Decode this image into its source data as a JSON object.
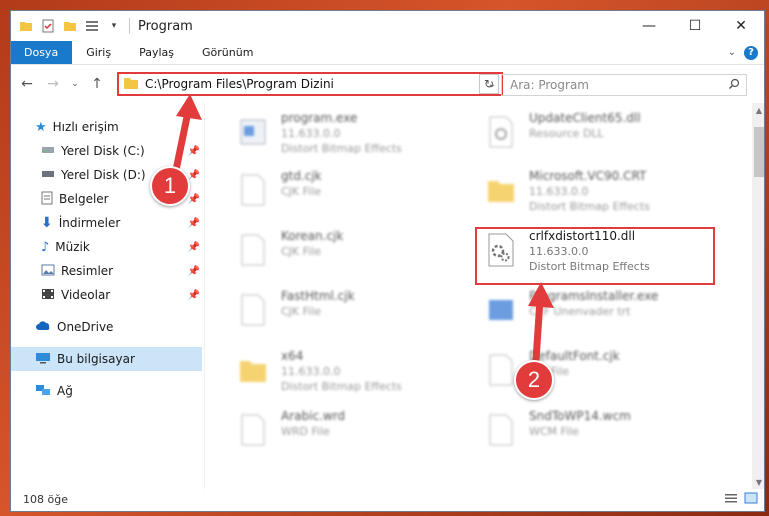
{
  "window": {
    "title": "Program"
  },
  "ribbon": {
    "tabs": [
      "Dosya",
      "Giriş",
      "Paylaş",
      "Görünüm"
    ],
    "help": "?"
  },
  "address": {
    "path": "C:\\Program Files\\Program Dizini",
    "search_placeholder": "Ara: Program"
  },
  "nav": {
    "quick_access": "Hızlı erişim",
    "items": [
      {
        "label": "Yerel Disk (C:)",
        "icon": "drive-icon"
      },
      {
        "label": "Yerel Disk (D:)",
        "icon": "drive-icon"
      },
      {
        "label": "Belgeler",
        "icon": "documents-icon"
      },
      {
        "label": "İndirmeler",
        "icon": "download-icon"
      },
      {
        "label": "Müzik",
        "icon": "music-icon"
      },
      {
        "label": "Resimler",
        "icon": "pictures-icon"
      },
      {
        "label": "Videolar",
        "icon": "video-icon"
      }
    ],
    "onedrive": "OneDrive",
    "this_pc": "Bu bilgisayar",
    "network": "Ağ"
  },
  "files": {
    "left": [
      {
        "name": "program.exe",
        "line1": "11.633.0.0",
        "line2": "Distort Bitmap Effects"
      },
      {
        "name": "gtd.cjk",
        "line1": "CJK File",
        "line2": ""
      },
      {
        "name": "Korean.cjk",
        "line1": "CJK File",
        "line2": ""
      },
      {
        "name": "FastHtml.cjk",
        "line1": "CJK File",
        "line2": ""
      },
      {
        "name": "x64",
        "line1": "11.633.0.0",
        "line2": "Distort Bitmap Effects"
      },
      {
        "name": "Arabic.wrd",
        "line1": "WRD File",
        "line2": ""
      }
    ],
    "right": [
      {
        "name": "UpdateClient65.dll",
        "line1": "Resource DLL",
        "line2": ""
      },
      {
        "name": "Microsoft.VC90.CRT",
        "line1": "11.633.0.0",
        "line2": "Distort Bitmap Effects"
      },
      {
        "name": "crlfxdistort110.dll",
        "line1": "11.633.0.0",
        "line2": "Distort Bitmap Effects"
      },
      {
        "name": "ProgramsInstaller.exe",
        "line1": "CEF Unenvader trt",
        "line2": ""
      },
      {
        "name": "DefaultFont.cjk",
        "line1": "CJK File",
        "line2": ""
      },
      {
        "name": "SndToWP14.wcm",
        "line1": "WCM File",
        "line2": ""
      }
    ]
  },
  "status": {
    "count": "108 öğe"
  },
  "markers": [
    "1",
    "2"
  ],
  "colors": {
    "accent": "#1979ca",
    "highlight": "#e23b3b",
    "selected": "#cce4f7"
  }
}
